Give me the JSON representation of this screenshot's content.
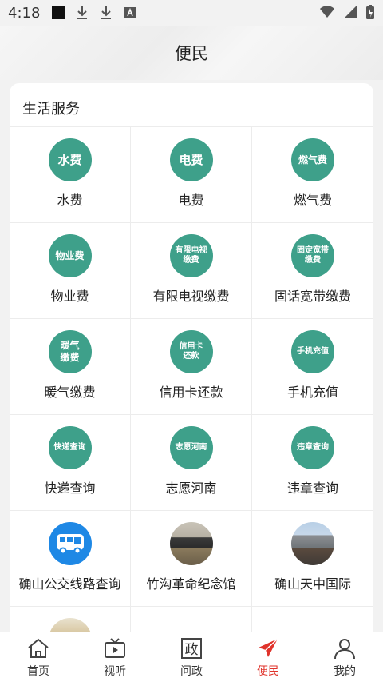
{
  "status_bar": {
    "time": "4:18"
  },
  "header": {
    "title": "便民"
  },
  "section": {
    "title": "生活服务"
  },
  "services": [
    {
      "label": "水费",
      "icon_text": "水费",
      "icon": "water-fee-icon"
    },
    {
      "label": "电费",
      "icon_text": "电费",
      "icon": "electricity-fee-icon"
    },
    {
      "label": "燃气费",
      "icon_text": "燃气费",
      "icon": "gas-fee-icon"
    },
    {
      "label": "物业费",
      "icon_text": "物业费",
      "icon": "property-fee-icon"
    },
    {
      "label": "有限电视缴费",
      "icon_text": "有限电视缴费",
      "icon": "cable-tv-fee-icon"
    },
    {
      "label": "固话宽带缴费",
      "icon_text": "固定宽带缴费",
      "icon": "broadband-fee-icon"
    },
    {
      "label": "暖气缴费",
      "icon_text": "暖气缴费",
      "icon": "heating-fee-icon"
    },
    {
      "label": "信用卡还款",
      "icon_text": "信用卡还款",
      "icon": "credit-card-icon"
    },
    {
      "label": "手机充值",
      "icon_text": "手机充值",
      "icon": "phone-topup-icon"
    },
    {
      "label": "快递查询",
      "icon_text": "快递查询",
      "icon": "express-query-icon"
    },
    {
      "label": "志愿河南",
      "icon_text": "志愿河南",
      "icon": "volunteer-icon"
    },
    {
      "label": "违章查询",
      "icon_text": "违章查询",
      "icon": "traffic-violation-icon"
    },
    {
      "label": "确山公交线路查询",
      "icon_text": "",
      "icon": "bus-icon"
    },
    {
      "label": "竹沟革命纪念馆",
      "icon_text": "",
      "icon": "memorial-photo-icon"
    },
    {
      "label": "确山天中国际",
      "icon_text": "",
      "icon": "building-photo-icon"
    }
  ],
  "tabs": [
    {
      "label": "首页",
      "icon": "home-icon"
    },
    {
      "label": "视听",
      "icon": "tv-icon"
    },
    {
      "label": "问政",
      "icon": "politics-icon",
      "icon_text": "政"
    },
    {
      "label": "便民",
      "icon": "send-icon"
    },
    {
      "label": "我的",
      "icon": "user-icon"
    }
  ],
  "colors": {
    "accent": "#e0332b",
    "service_green": "#3ea08a",
    "bus_blue": "#1e88e5"
  }
}
